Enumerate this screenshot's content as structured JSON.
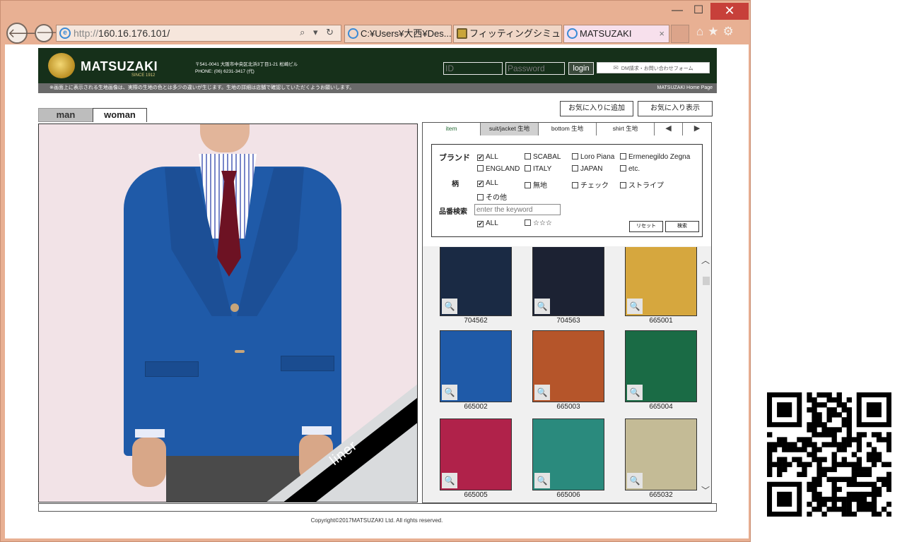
{
  "browser": {
    "window_buttons": {
      "minimize": "—",
      "maximize": "☐",
      "close": "✕"
    },
    "address": {
      "protocol": "http://",
      "host": "160.16.176.101/",
      "controls": "⌕ ▾ ↻"
    },
    "tabs": [
      {
        "label": "C:¥Users¥大西¥Des..."
      },
      {
        "label": "フィッティングシミュレーシ..."
      },
      {
        "label": "MATSUZAKI",
        "close": "×"
      }
    ],
    "toolbar_icons": "⌂★⚙"
  },
  "site": {
    "logo": "MATSUZAKI",
    "since": "SINCE 1912",
    "address_line1": "〒541-0041 大阪市中央区北浜3丁目1-21 松崎ビル",
    "address_line2": "PHONE: (06) 6231-3417 (代)",
    "id_placeholder": "ID",
    "password_placeholder": "Password",
    "login_label": "login",
    "dm_label": "DM請求・お問い合わせフォーム",
    "notice": "※画面上に表示される生地画像は、実際の生地の色とは多少の違いが生じます。生地の詳細は店舗で確認していただくようお願いします。",
    "home_link": "MATSUZAKI Home Page"
  },
  "gender_tabs": {
    "man": "man",
    "woman": "woman"
  },
  "preview": {
    "liner_label": "liner"
  },
  "favorites": {
    "add": "お気に入りに追加",
    "show": "お気に入り表示"
  },
  "fabric_tabs": {
    "item": "item",
    "suit": "suit/jacket 生地",
    "bottom": "bottom 生地",
    "shirt": "shirt 生地",
    "prev": "◀",
    "next": "▶"
  },
  "filters": {
    "brand_label": "ブランド",
    "brand_options": [
      {
        "label": "ALL",
        "checked": "✔"
      },
      {
        "label": "SCABAL",
        "checked": ""
      },
      {
        "label": "Loro Piana",
        "checked": ""
      },
      {
        "label": "Ermenegildo Zegna",
        "checked": ""
      },
      {
        "label": "ENGLAND",
        "checked": ""
      },
      {
        "label": "ITALY",
        "checked": ""
      },
      {
        "label": "JAPAN",
        "checked": ""
      },
      {
        "label": "etc.",
        "checked": ""
      }
    ],
    "pattern_label": "柄",
    "pattern_options": [
      {
        "label": "ALL",
        "checked": "✔"
      },
      {
        "label": "無地",
        "checked": ""
      },
      {
        "label": "チェック",
        "checked": ""
      },
      {
        "label": "ストライプ",
        "checked": ""
      },
      {
        "label": "その他",
        "checked": ""
      }
    ],
    "keyword_label": "品番検索",
    "keyword_placeholder": "enter the keyword",
    "rating_options": [
      {
        "label": "ALL",
        "checked": "✔"
      },
      {
        "label": "☆☆☆",
        "checked": ""
      }
    ],
    "reset_label": "リセット",
    "search_label": "検索"
  },
  "swatches": [
    {
      "code": "704562",
      "color": "#1a2a44"
    },
    {
      "code": "704563",
      "color": "#1c2233"
    },
    {
      "code": "665001",
      "color": "#d6a73e"
    },
    {
      "code": "665002",
      "color": "#1f5aa8"
    },
    {
      "code": "665003",
      "color": "#b5552a"
    },
    {
      "code": "665004",
      "color": "#1a6b45"
    },
    {
      "code": "665005",
      "color": "#b0224a"
    },
    {
      "code": "665006",
      "color": "#2a8a7d"
    },
    {
      "code": "665032",
      "color": "#c4bb96"
    }
  ],
  "scroll": {
    "up": "︿",
    "down": "﹀"
  },
  "footer": {
    "copyright": "Copyright©2017MATSUZAKI Ltd. All rights reserved."
  },
  "icons": {
    "zoom": "🔍"
  }
}
